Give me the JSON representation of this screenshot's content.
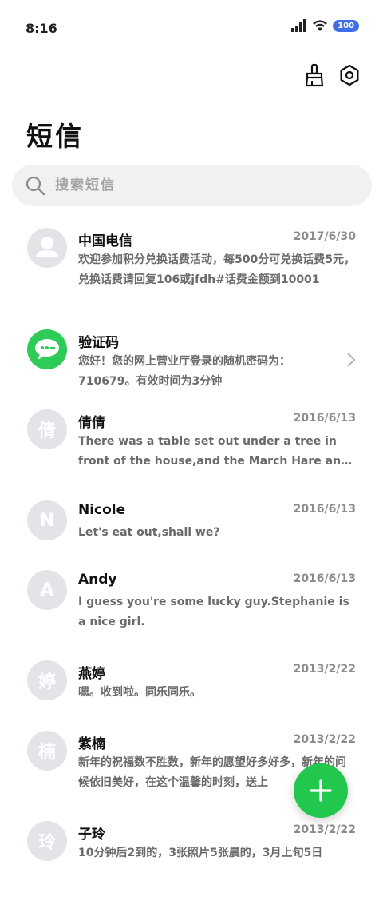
{
  "status_bar": {
    "time": "8:16",
    "battery": "100"
  },
  "header": {
    "title": "短信"
  },
  "search": {
    "placeholder": "搜索短信"
  },
  "conversations": [
    {
      "name": "中国电信",
      "date": "2017/6/30",
      "preview": "欢迎参加积分兑换话费活动，每500分可兑换话费5元，兑换话费请回复106或jfdh#话费金额到10001",
      "avatar_text": "",
      "avatar_icon": "person-icon"
    },
    {
      "name": "验证码",
      "date": "",
      "preview": "您好！您的网上营业厅登录的随机密码为：710679。有效时间为3分钟",
      "avatar_text": "",
      "avatar_icon": "message-icon"
    },
    {
      "name": "倩倩",
      "date": "2016/6/13",
      "preview": "There was a table set out under a tree in front of the house,and the March Hare and the Hatter were having tea at it",
      "avatar_text": "倩"
    },
    {
      "name": "Nicole",
      "date": "2016/6/13",
      "preview": "Let's eat out,shall we?",
      "avatar_text": "N"
    },
    {
      "name": "Andy",
      "date": "2016/6/13",
      "preview": "I guess you're some lucky guy.Stephanie is a nice girl.",
      "avatar_text": "A"
    },
    {
      "name": "燕婷",
      "date": "2013/2/22",
      "preview": "嗯。收到啦。同乐同乐。",
      "avatar_text": "婷"
    },
    {
      "name": "紫楠",
      "date": "2013/2/22",
      "preview": "新年的祝福数不胜数，新年的愿望好多好多，新年的问候依旧美好，在这个温馨的时刻，送上",
      "avatar_text": "楠"
    },
    {
      "name": "子玲",
      "date": "2013/2/22",
      "preview": "10分钟后2到的，3张照片5张晨的，3月上旬5日",
      "avatar_text": "玲"
    }
  ],
  "colors": {
    "accent": "#22c84e",
    "avatar_bg": "#e3e4e7",
    "battery": "#3e6fe8"
  }
}
